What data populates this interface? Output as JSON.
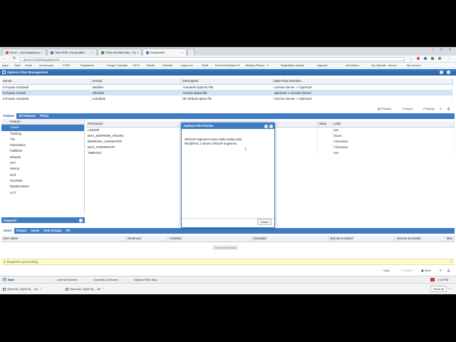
{
  "browser": {
    "tabs": [
      {
        "label": "Inbox - rmunday@open",
        "active": false
      },
      {
        "label": "Task 8036: test qualifier",
        "active": false
      },
      {
        "label": "Flash tutorials links - Go",
        "active": false
      },
      {
        "label": "EasyAdmin",
        "active": true
      },
      {
        "label": "",
        "active": false
      }
    ],
    "address": "demo.k.2019/EasyAdmin2/#",
    "bookmarks": [
      "Apps",
      "Drive",
      "Gmail",
      "remote pets",
      "CTRS",
      "EasyAdmin",
      "Google Translate",
      "VSTS",
      "Mantis",
      "Calendar",
      "maps.crm",
      "SaaS",
      "Find and Replace To",
      "Meeting Planner - F",
      "Registration databa",
      "bigomab",
      "win10demo",
      "QA_Reports",
      "demo4",
      "My account"
    ]
  },
  "app": {
    "title": "Options Files Management",
    "files_table": {
      "columns": [
        "Server",
        "Vendor",
        "Description",
        "Data Flow Direction"
      ],
      "rows": [
        {
          "server": "In-house Autodesk",
          "vendor": "adskflex",
          "description": "Autodesk Options File",
          "direction": "License Server -> OpenLM",
          "selected": false
        },
        {
          "server": "In-house ArcGIS",
          "vendor": "ARCGIS",
          "description": "ArcGIS option file",
          "direction": "OpenLM -> License Server",
          "selected": true
        },
        {
          "server": "In-house Autodesk",
          "vendor": "Autodesk",
          "description": "the default option file",
          "direction": "License Server -> OpenLM",
          "selected": false
        }
      ]
    },
    "toolbar": {
      "preview": "Preview",
      "export": "Export",
      "deploy": "Deploy"
    },
    "feature_tabs": [
      "Feature",
      "All Features",
      "Policy"
    ],
    "features_header": "Feature",
    "features": [
      "Viewer",
      "Tracking",
      "TIN",
      "Schematics",
      "Publisher",
      "Network",
      "3TX",
      "Interop",
      "Grid",
      "GeoStats",
      "DataReViewer",
      "ACT"
    ],
    "selected_feature": "Viewer",
    "keyword_label": "Keyword",
    "permission_table": {
      "columns": [
        "Permission",
        "Value",
        "Units"
      ],
      "rows": [
        {
          "permission": "LINGER",
          "value": "",
          "units": "sec"
        },
        {
          "permission": "MAX_BORROW_HOURS",
          "value": "",
          "units": "hours"
        },
        {
          "permission": "BORROW_LOWWATER",
          "value": "",
          "units": "# licenses"
        },
        {
          "permission": "MAX_OVERDRAFT",
          "value": "",
          "units": "# licenses"
        },
        {
          "permission": "TIMEOUT",
          "value": "",
          "units": "sec"
        }
      ]
    },
    "preview_modal": {
      "title": "Options File Preview",
      "lines": [
        "GROUP engineers naveo tashe tsalay adal",
        "RESERVE 1 Viewer GROUP engineers"
      ],
      "close_label": "Close"
    },
    "user_tabs": [
      "Users",
      "Groups",
      "Hosts",
      "Host Groups",
      "IPs"
    ],
    "users_table": {
      "columns": [
        "User name",
        "Reserved",
        "Included",
        "Excluded",
        "Borrow Included",
        "Borrow Excluded",
        "Max"
      ],
      "empty_message": "No results found"
    },
    "notice": "Request is processing",
    "bottom_toolbar": {
      "add": "Add",
      "delete": "Delete",
      "save": "Save"
    },
    "taskbar": {
      "start": "Start",
      "items": [
        "License Servers",
        "Currently Consume...",
        "Options Files Man..."
      ],
      "time": "2:15 PM"
    }
  },
  "downloads": {
    "items": [
      "OpenLM_OpenLM_...tar",
      "OpenLM_OpenLM_...tar"
    ],
    "show_all": "Show all"
  },
  "colors": {
    "accent": "#3f7cc4",
    "selection": "#cfe2f6",
    "notice": "#fffbc9"
  }
}
